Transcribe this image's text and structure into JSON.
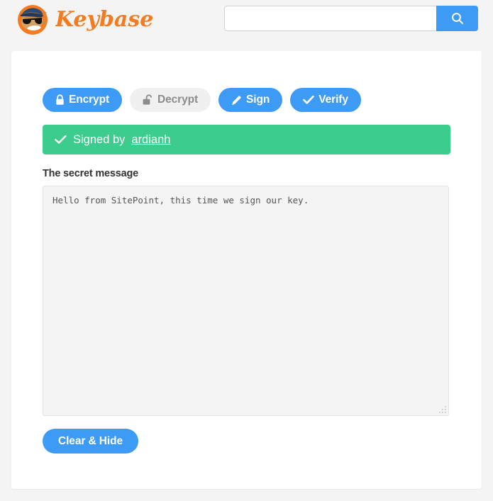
{
  "colors": {
    "page_bg": "#f4f4f5",
    "card_bg": "#ffffff",
    "accent_blue": "#3d9af5",
    "success_green": "#3ccd8e",
    "muted_tab_bg": "#f0f0f0",
    "muted_tab_text": "#8c8c8c",
    "brand_orange": "#f47b20",
    "textarea_bg": "#f4f4f4"
  },
  "header": {
    "brand_name": "Keybase",
    "logo_icon": "keybase-mascot-icon",
    "search": {
      "value": "",
      "placeholder": "",
      "button_icon": "search-icon"
    }
  },
  "main": {
    "tabs": [
      {
        "label": "Encrypt",
        "icon": "lock-closed-icon",
        "state": "active"
      },
      {
        "label": "Decrypt",
        "icon": "lock-open-icon",
        "state": "muted"
      },
      {
        "label": "Sign",
        "icon": "pencil-icon",
        "state": "active"
      },
      {
        "label": "Verify",
        "icon": "check-icon",
        "state": "active"
      }
    ],
    "alert": {
      "icon": "check-icon",
      "text": "Signed by",
      "link_text": "ardianh"
    },
    "field": {
      "label": "The secret message",
      "value": "Hello from SitePoint, this time we sign our key.",
      "placeholder": ""
    },
    "clear_button": {
      "label": "Clear & Hide"
    }
  }
}
